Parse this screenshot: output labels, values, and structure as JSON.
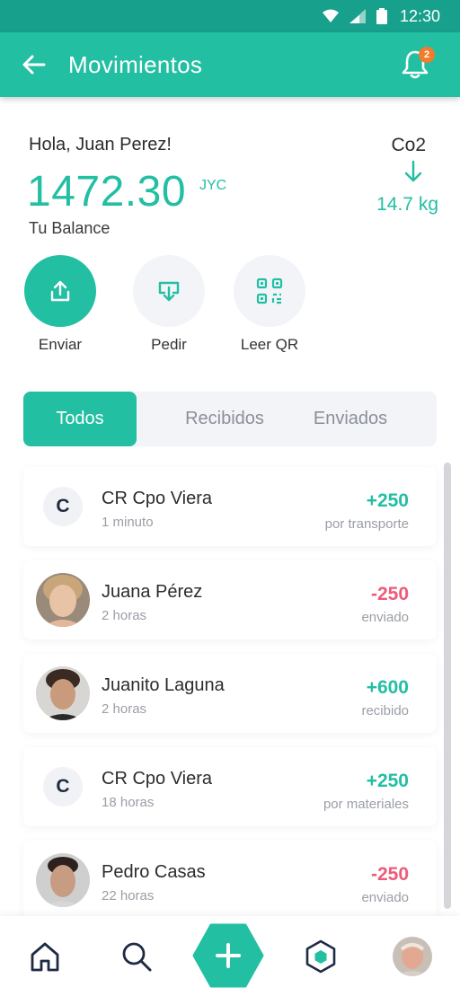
{
  "status_bar": {
    "time": "12:30"
  },
  "header": {
    "title": "Movimientos",
    "notification_count": "2"
  },
  "summary": {
    "greeting": "Hola, Juan Perez!",
    "balance": "1472.30",
    "currency": "JYC",
    "balance_label": "Tu Balance",
    "co2_label": "Co2",
    "co2_value": "14.7 kg"
  },
  "actions": [
    {
      "label": "Enviar",
      "icon": "upload-icon"
    },
    {
      "label": "Pedir",
      "icon": "download-icon"
    },
    {
      "label": "Leer QR",
      "icon": "qr-icon"
    }
  ],
  "tabs": [
    {
      "label": "Todos",
      "active": true
    },
    {
      "label": "Recibidos",
      "active": false
    },
    {
      "label": "Enviados",
      "active": false
    }
  ],
  "transactions": [
    {
      "name": "CR Cpo Viera",
      "time": "1 minuto",
      "amount": "+250",
      "description": "por transporte",
      "avatar": "initial",
      "initial": "C"
    },
    {
      "name": "Juana Pérez",
      "time": "2 horas",
      "amount": "-250",
      "description": "enviado",
      "avatar": "photo"
    },
    {
      "name": "Juanito Laguna",
      "time": "2 horas",
      "amount": "+600",
      "description": "recibido",
      "avatar": "photo"
    },
    {
      "name": "CR Cpo Viera",
      "time": "18 horas",
      "amount": "+250",
      "description": "por materiales",
      "avatar": "initial",
      "initial": "C"
    },
    {
      "name": "Pedro Casas",
      "time": "22 horas",
      "amount": "-250",
      "description": "enviado",
      "avatar": "photo"
    }
  ],
  "bottom_nav": [
    "home-icon",
    "search-icon",
    "add-icon",
    "recycle-icon",
    "profile-avatar"
  ],
  "colors": {
    "accent": "#22bfa3",
    "accent_dark": "#17a08c",
    "positive": "#22bfa3",
    "negative": "#ef5a7a",
    "badge": "#f27b2c"
  }
}
